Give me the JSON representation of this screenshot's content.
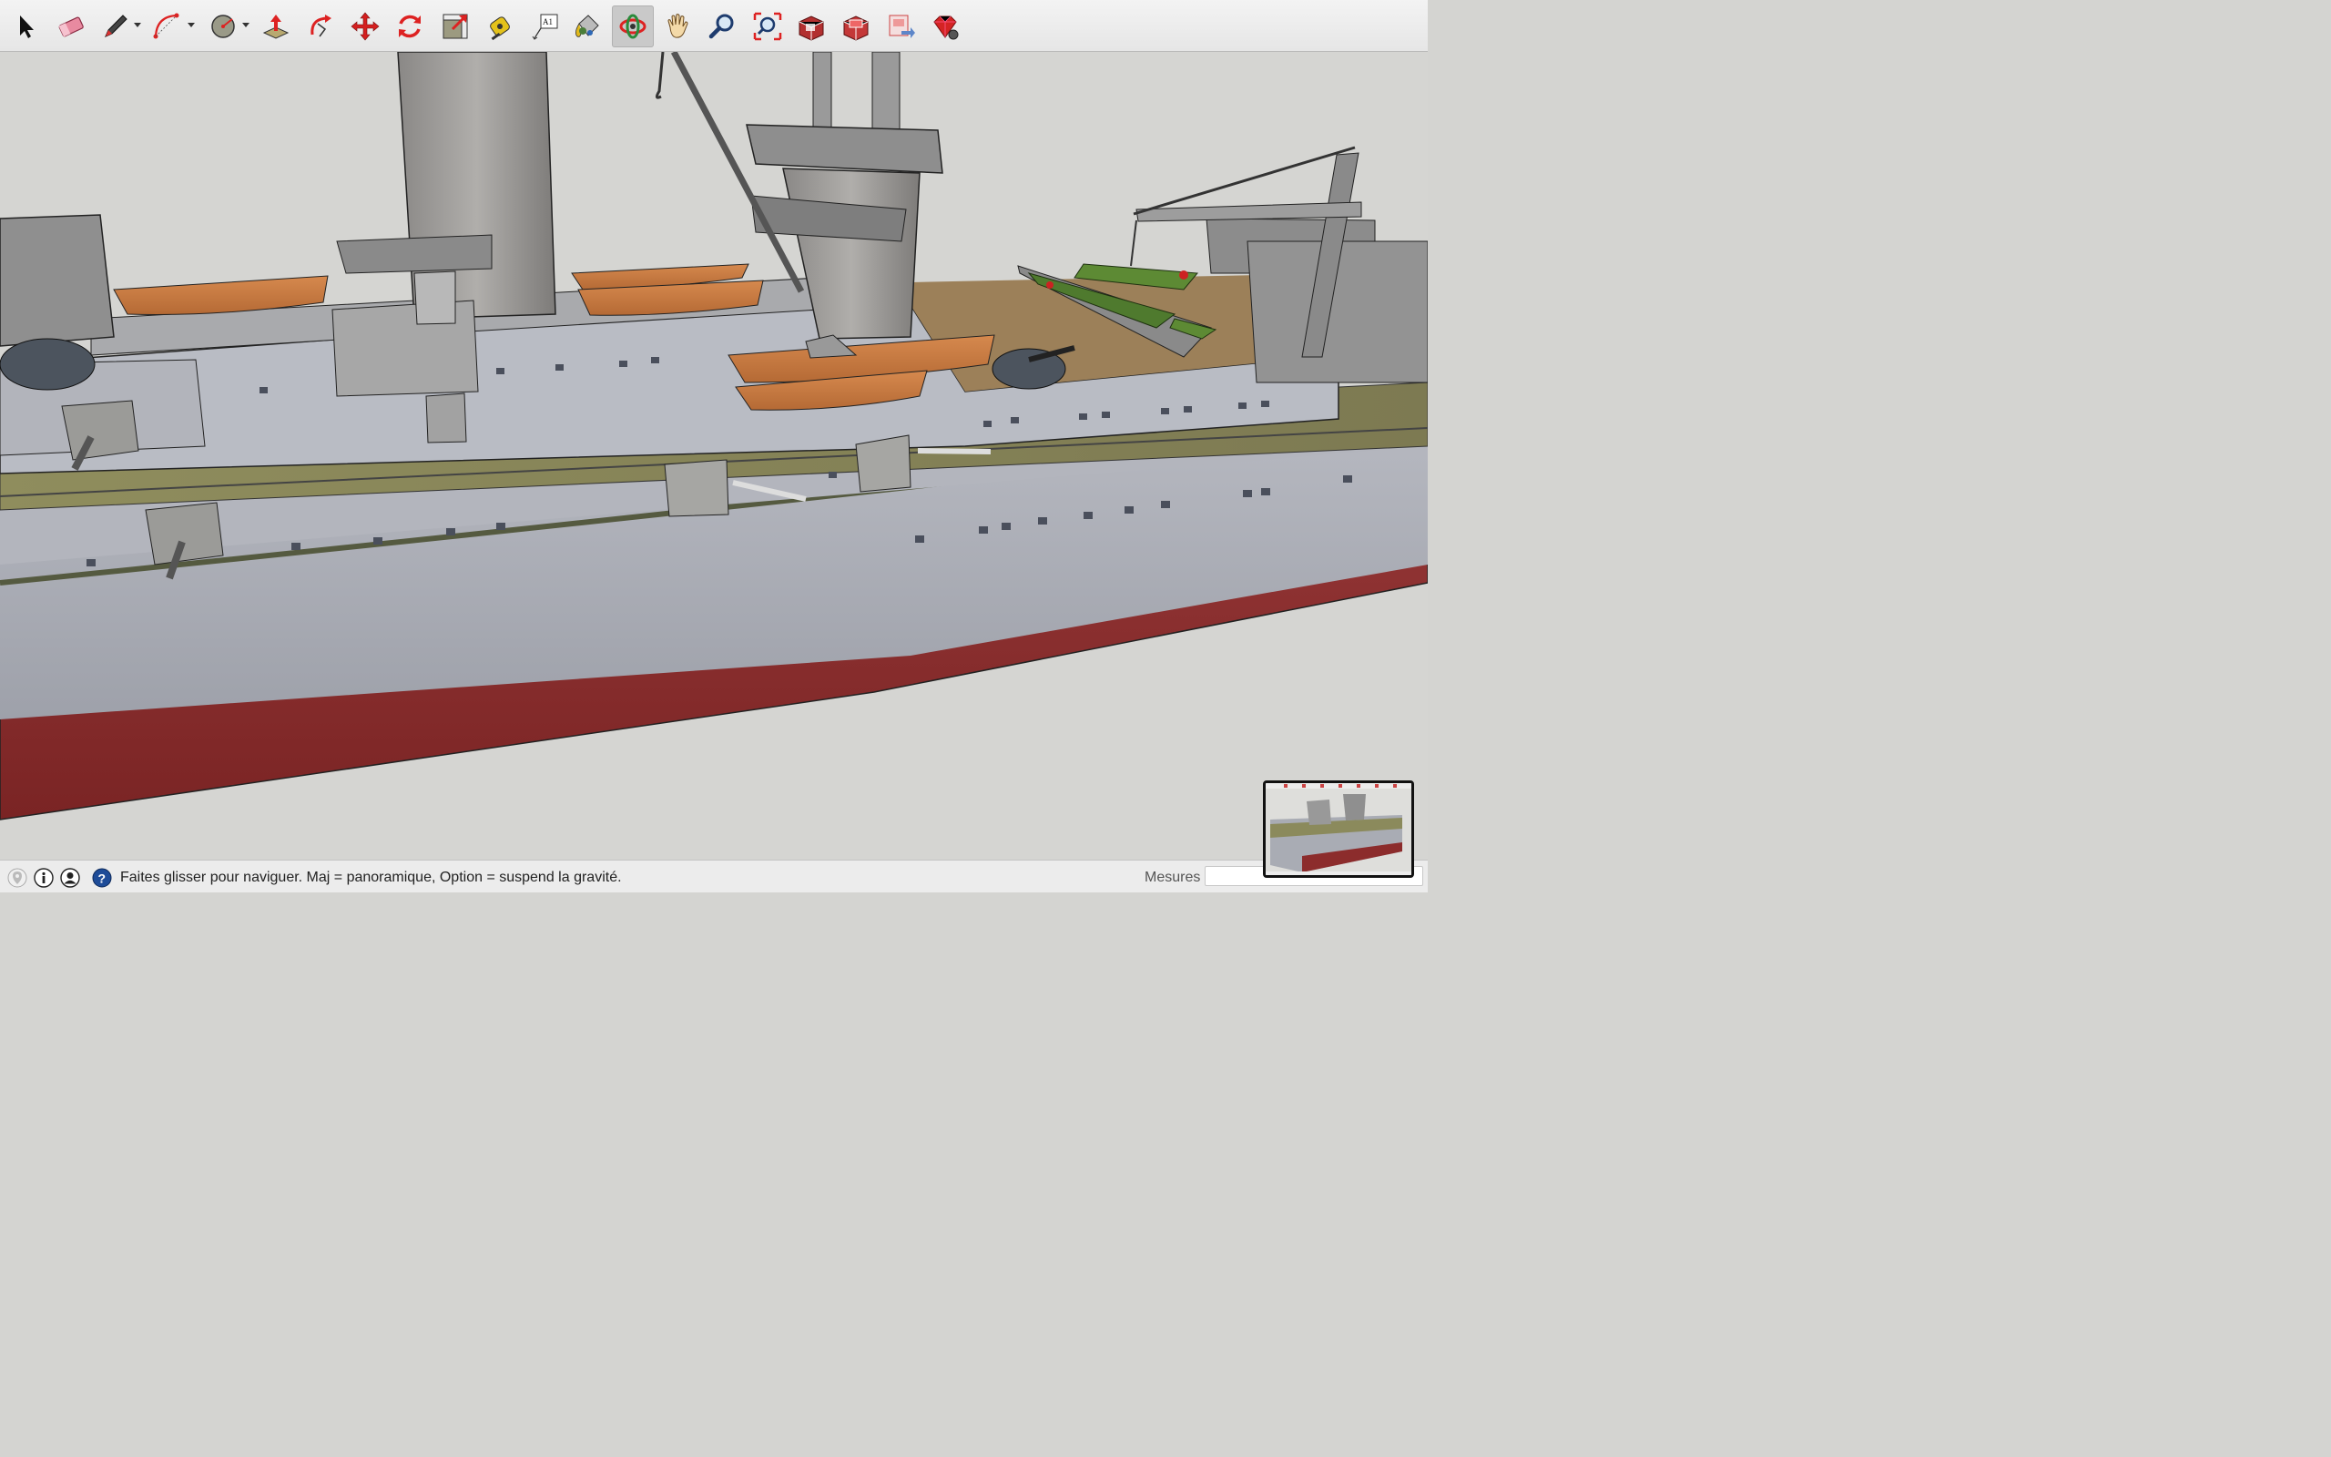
{
  "toolbar": {
    "tools": [
      {
        "id": "select",
        "icon": "select-arrow-icon",
        "active": false,
        "dropdown": false
      },
      {
        "id": "eraser",
        "icon": "eraser-icon",
        "active": false,
        "dropdown": false
      },
      {
        "id": "pencil",
        "icon": "pencil-line-icon",
        "active": false,
        "dropdown": true
      },
      {
        "id": "arc",
        "icon": "arc-icon",
        "active": false,
        "dropdown": true
      },
      {
        "id": "shapes",
        "icon": "circle-shape-icon",
        "active": false,
        "dropdown": true
      },
      {
        "id": "pushpull",
        "icon": "push-pull-icon",
        "active": false,
        "dropdown": false
      },
      {
        "id": "followme",
        "icon": "follow-me-icon",
        "active": false,
        "dropdown": false
      },
      {
        "id": "move",
        "icon": "move-icon",
        "active": false,
        "dropdown": false
      },
      {
        "id": "rotate",
        "icon": "rotate-icon",
        "active": false,
        "dropdown": false
      },
      {
        "id": "scale",
        "icon": "scale-icon",
        "active": false,
        "dropdown": false
      },
      {
        "id": "tape",
        "icon": "tape-measure-icon",
        "active": false,
        "dropdown": false
      },
      {
        "id": "text",
        "icon": "text-tool-icon",
        "label": "A1",
        "active": false,
        "dropdown": false
      },
      {
        "id": "paint",
        "icon": "paint-bucket-icon",
        "active": false,
        "dropdown": false
      },
      {
        "id": "orbit",
        "icon": "orbit-icon",
        "active": true,
        "dropdown": false
      },
      {
        "id": "pan",
        "icon": "pan-hand-icon",
        "active": false,
        "dropdown": false
      },
      {
        "id": "zoom",
        "icon": "zoom-icon",
        "active": false,
        "dropdown": false
      },
      {
        "id": "zoomextents",
        "icon": "zoom-extents-icon",
        "active": false,
        "dropdown": false
      },
      {
        "id": "warehouse",
        "icon": "3d-warehouse-icon",
        "active": false,
        "dropdown": false
      },
      {
        "id": "extension-warehouse",
        "icon": "extension-warehouse-icon",
        "active": false,
        "dropdown": false
      },
      {
        "id": "send-layout",
        "icon": "send-to-layout-icon",
        "active": false,
        "dropdown": false
      },
      {
        "id": "ruby",
        "icon": "ruby-console-icon",
        "active": false,
        "dropdown": false
      }
    ]
  },
  "status": {
    "icons": [
      "geolocation-icon",
      "info-credits-icon",
      "user-account-icon",
      "help-icon"
    ],
    "message": "Faites glisser pour naviguer. Maj = panoramique, Option =  suspend la gravité.",
    "measurements_label": "Mesures",
    "measurements_value": ""
  },
  "viewport": {
    "background": "#d5d5d2",
    "hull_color": "#a9acb4",
    "waterline_color": "#8c2c2c",
    "deck_color": "#8b8a5c"
  }
}
